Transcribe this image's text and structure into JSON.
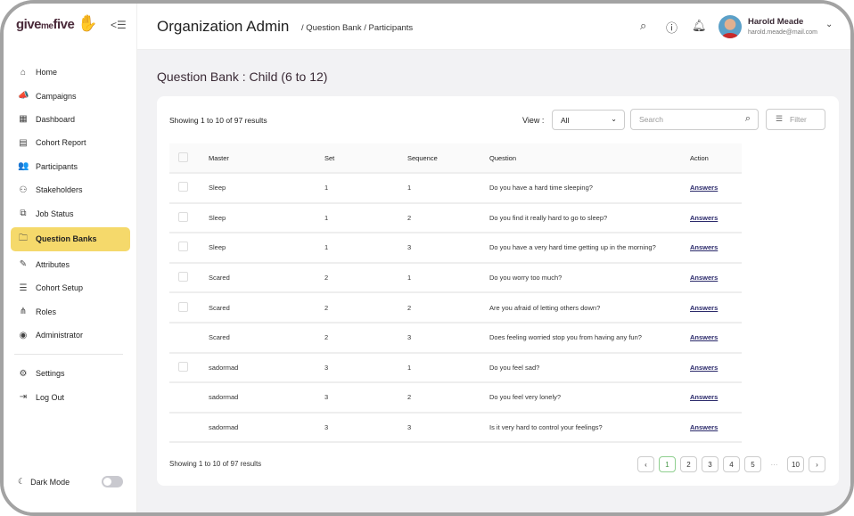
{
  "logo": {
    "text": "give me five"
  },
  "sidebar": {
    "items": [
      {
        "label": "Home",
        "icon": "home-icon",
        "glyph": "⌂"
      },
      {
        "label": "Campaigns",
        "icon": "megaphone-icon",
        "glyph": "📣"
      },
      {
        "label": "Dashboard",
        "icon": "grid-icon",
        "glyph": "▦"
      },
      {
        "label": "Cohort Report",
        "icon": "report-icon",
        "glyph": "▤"
      },
      {
        "label": "Participants",
        "icon": "users-icon",
        "glyph": "👥"
      },
      {
        "label": "Stakeholders",
        "icon": "stakeholders-icon",
        "glyph": "⚇"
      },
      {
        "label": "Job Status",
        "icon": "job-icon",
        "glyph": "⧉"
      },
      {
        "label": "Question Banks",
        "icon": "question-folder-icon",
        "glyph": "🗀",
        "active": true
      },
      {
        "label": "Attributes",
        "icon": "attributes-icon",
        "glyph": "✎"
      },
      {
        "label": "Cohort Setup",
        "icon": "setup-icon",
        "glyph": "☰"
      },
      {
        "label": "Roles",
        "icon": "roles-icon",
        "glyph": "⋔"
      },
      {
        "label": "Administrator",
        "icon": "admin-icon",
        "glyph": "◉"
      }
    ],
    "bottom": [
      {
        "label": "Settings",
        "icon": "gear-icon",
        "glyph": "⚙"
      },
      {
        "label": "Log Out",
        "icon": "logout-icon",
        "glyph": "⇥"
      }
    ],
    "dark_mode": "Dark Mode"
  },
  "header": {
    "title": "Organization Admin",
    "breadcrumb": "/ Question Bank / Participants",
    "user": {
      "name": "Harold Meade",
      "email": "harold.meade@mail.com"
    }
  },
  "page": {
    "title": "Question Bank : Child (6 to 12)",
    "showing": "Showing 1 to 10 of 97 results",
    "view_label": "View :",
    "view_value": "All",
    "search_placeholder": "Search",
    "filter_label": "Filter",
    "columns": [
      "Master",
      "Set",
      "Sequence",
      "Question",
      "Action"
    ],
    "rows": [
      [
        "Sleep",
        "1",
        "1",
        "Do you have a hard time sleeping?",
        "Answers"
      ],
      [
        "Sleep",
        "1",
        "2",
        "Do you find it really hard to go to sleep?",
        "Answers"
      ],
      [
        "Sleep",
        "1",
        "3",
        "Do you have a very hard time getting up in the morning?",
        "Answers"
      ],
      [
        "Scared",
        "2",
        "1",
        "Do you worry too much?",
        "Answers"
      ],
      [
        "Scared",
        "2",
        "2",
        "Are you afraid of letting others down?",
        "Answers"
      ],
      [
        "Scared",
        "2",
        "3",
        "Does feeling worried stop you from having any fun?",
        "Answers"
      ],
      [
        "sadormad",
        "3",
        "1",
        "Do you feel sad?",
        "Answers"
      ],
      [
        "sadormad",
        "3",
        "2",
        "Do you feel very lonely?",
        "Answers"
      ],
      [
        "sadormad",
        "3",
        "3",
        "Is it very hard to control your feelings?",
        "Answers"
      ]
    ],
    "footer": "Showing 1 to 10 of 97 results",
    "pages": [
      "‹",
      "1",
      "2",
      "3",
      "4",
      "5",
      "···",
      "10",
      "›"
    ],
    "current_page": "1"
  },
  "colors": {
    "accent": "#f5d96b",
    "brand": "#e8603c",
    "active_page": "#4a9a4a"
  }
}
